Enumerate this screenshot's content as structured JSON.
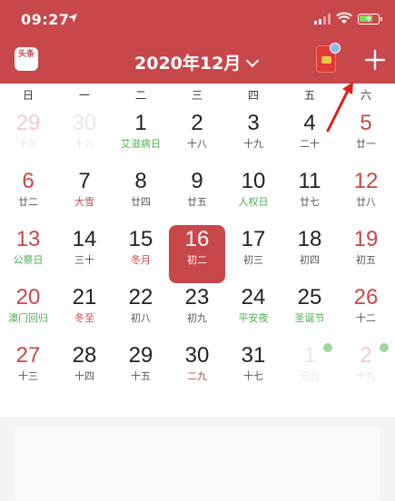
{
  "status": {
    "time": "09:27"
  },
  "header": {
    "title": "2020年12月",
    "logo_text": "头条"
  },
  "weekdays": [
    "日",
    "一",
    "二",
    "三",
    "四",
    "五",
    "六"
  ],
  "colors": {
    "accent": "#c8474a",
    "red": "#c8474a",
    "green": "#4caf50",
    "text": "#222222",
    "lunar_text": "#555555"
  },
  "weeks": [
    [
      {
        "day": "29",
        "lunar": "十五",
        "tone": "dim-red"
      },
      {
        "day": "30",
        "lunar": "十六",
        "tone": "dim"
      },
      {
        "day": "1",
        "lunar": "艾滋病日",
        "tone": "green"
      },
      {
        "day": "2",
        "lunar": "十八",
        "tone": "normal"
      },
      {
        "day": "3",
        "lunar": "十九",
        "tone": "normal"
      },
      {
        "day": "4",
        "lunar": "二十",
        "tone": "normal"
      },
      {
        "day": "5",
        "lunar": "廿一",
        "tone": "weekend"
      }
    ],
    [
      {
        "day": "6",
        "lunar": "廿二",
        "tone": "weekend"
      },
      {
        "day": "7",
        "lunar": "大雪",
        "tone": "red-lunar"
      },
      {
        "day": "8",
        "lunar": "廿四",
        "tone": "normal"
      },
      {
        "day": "9",
        "lunar": "廿五",
        "tone": "normal"
      },
      {
        "day": "10",
        "lunar": "人权日",
        "tone": "green"
      },
      {
        "day": "11",
        "lunar": "廿七",
        "tone": "normal"
      },
      {
        "day": "12",
        "lunar": "廿八",
        "tone": "weekend"
      }
    ],
    [
      {
        "day": "13",
        "lunar": "公祭日",
        "tone": "weekend-green"
      },
      {
        "day": "14",
        "lunar": "三十",
        "tone": "normal"
      },
      {
        "day": "15",
        "lunar": "冬月",
        "tone": "red-lunar"
      },
      {
        "day": "16",
        "lunar": "初二",
        "tone": "selected"
      },
      {
        "day": "17",
        "lunar": "初三",
        "tone": "normal"
      },
      {
        "day": "18",
        "lunar": "初四",
        "tone": "normal"
      },
      {
        "day": "19",
        "lunar": "初五",
        "tone": "weekend"
      }
    ],
    [
      {
        "day": "20",
        "lunar": "澳门回归",
        "tone": "weekend-green"
      },
      {
        "day": "21",
        "lunar": "冬至",
        "tone": "red-lunar"
      },
      {
        "day": "22",
        "lunar": "初八",
        "tone": "normal"
      },
      {
        "day": "23",
        "lunar": "初九",
        "tone": "normal"
      },
      {
        "day": "24",
        "lunar": "平安夜",
        "tone": "green"
      },
      {
        "day": "25",
        "lunar": "圣诞节",
        "tone": "green"
      },
      {
        "day": "26",
        "lunar": "十二",
        "tone": "weekend"
      }
    ],
    [
      {
        "day": "27",
        "lunar": "十三",
        "tone": "weekend"
      },
      {
        "day": "28",
        "lunar": "十四",
        "tone": "normal"
      },
      {
        "day": "29",
        "lunar": "十五",
        "tone": "normal"
      },
      {
        "day": "30",
        "lunar": "二九",
        "tone": "red-lunar"
      },
      {
        "day": "31",
        "lunar": "十七",
        "tone": "normal"
      },
      {
        "day": "1",
        "lunar": "元旦",
        "tone": "dim-green",
        "dot": true
      },
      {
        "day": "2",
        "lunar": "十九",
        "tone": "dim-red",
        "dot": true
      }
    ]
  ]
}
